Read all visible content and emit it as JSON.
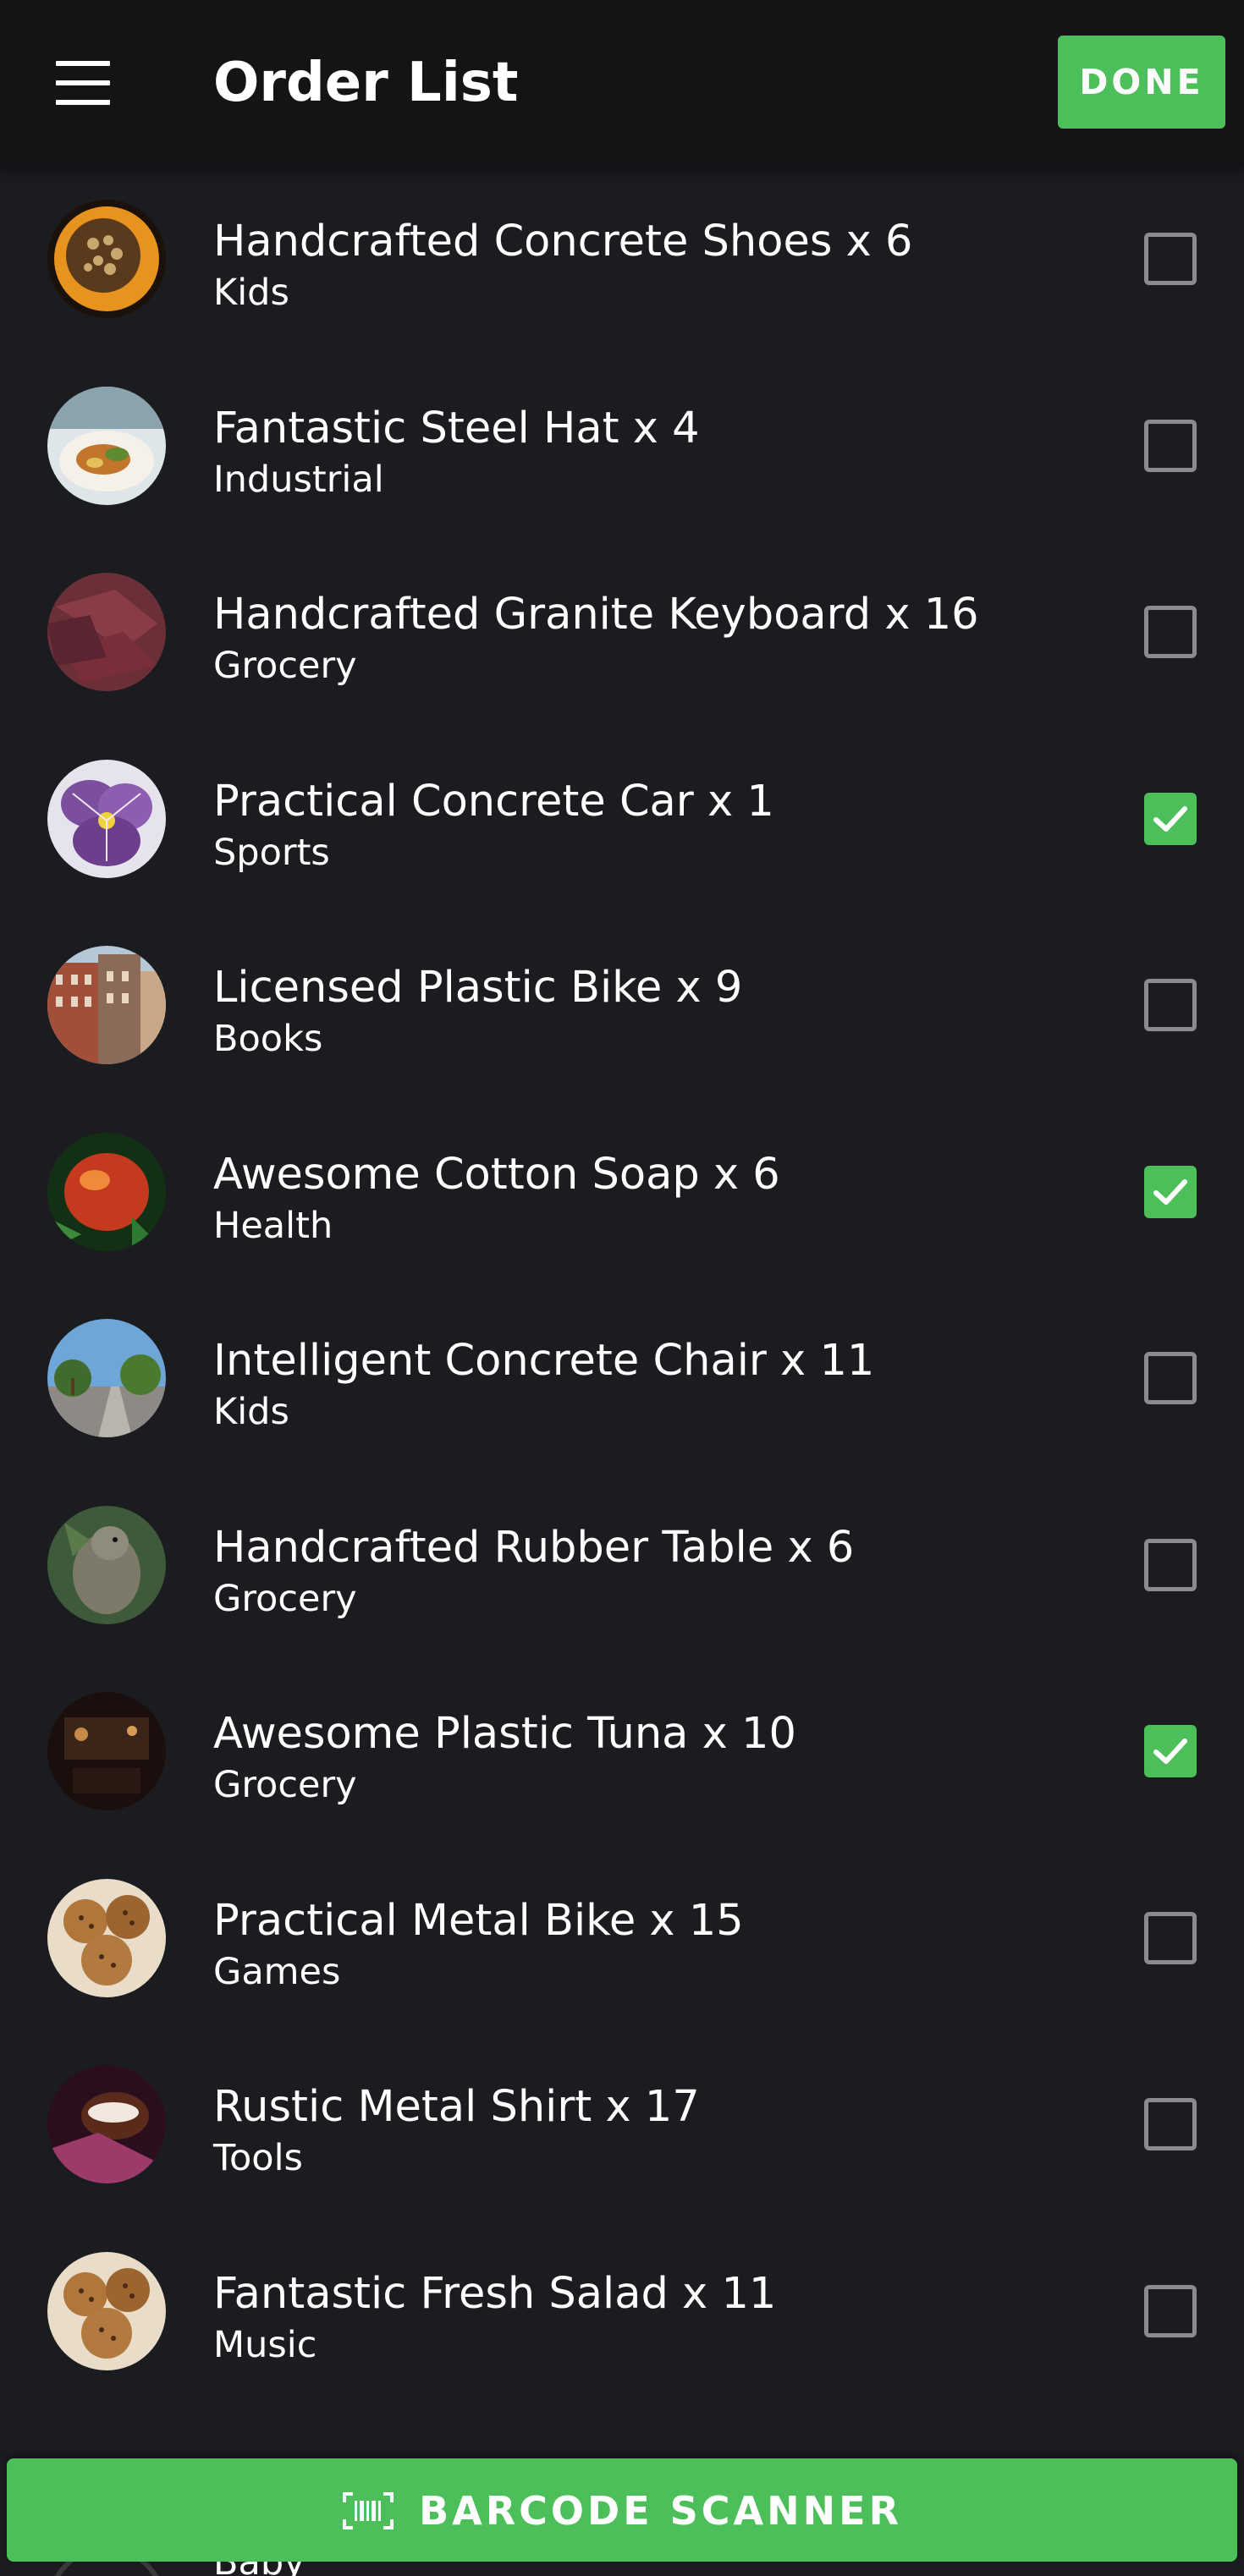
{
  "header": {
    "title": "Order List",
    "done_label": "DONE",
    "menu_icon": "hamburger-menu-icon"
  },
  "items": [
    {
      "title": "Handcrafted Concrete Shoes x 6",
      "category": "Kids",
      "checked": false,
      "thumb": "food-icon"
    },
    {
      "title": "Fantastic Steel Hat x 4",
      "category": "Industrial",
      "checked": false,
      "thumb": "food-icon"
    },
    {
      "title": "Handcrafted Granite Keyboard x 16",
      "category": "Grocery",
      "checked": false,
      "thumb": "food-icon"
    },
    {
      "title": "Practical Concrete Car x 1",
      "category": "Sports",
      "checked": true,
      "thumb": "flower-icon"
    },
    {
      "title": "Licensed Plastic Bike x 9",
      "category": "Books",
      "checked": false,
      "thumb": "building-icon"
    },
    {
      "title": "Awesome Cotton Soap x 6",
      "category": "Health",
      "checked": true,
      "thumb": "food-icon"
    },
    {
      "title": "Intelligent Concrete Chair x 11",
      "category": "Kids",
      "checked": false,
      "thumb": "street-icon"
    },
    {
      "title": "Handcrafted Rubber Table x 6",
      "category": "Grocery",
      "checked": false,
      "thumb": "animal-icon"
    },
    {
      "title": "Awesome Plastic Tuna x 10",
      "category": "Grocery",
      "checked": true,
      "thumb": "interior-icon"
    },
    {
      "title": "Practical Metal Bike x 15",
      "category": "Games",
      "checked": false,
      "thumb": "food-icon"
    },
    {
      "title": "Rustic Metal Shirt x 17",
      "category": "Tools",
      "checked": false,
      "thumb": "food-icon"
    },
    {
      "title": "Fantastic Fresh Salad x 11",
      "category": "Music",
      "checked": false,
      "thumb": "food-icon"
    }
  ],
  "partial_item": {
    "category": "Baby"
  },
  "footer": {
    "barcode_label": "BARCODE SCANNER",
    "barcode_icon": "barcode-scan-icon"
  },
  "colors": {
    "accent": "#4cbf5a",
    "background": "#1b1c20",
    "topbar": "#141416"
  }
}
